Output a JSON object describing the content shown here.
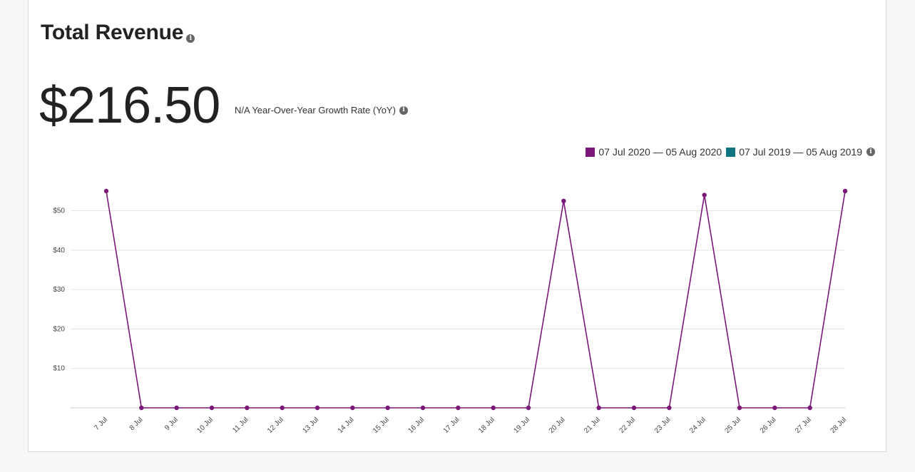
{
  "card": {
    "title": "Total Revenue",
    "value": "$216.50",
    "yoy_text": "N/A Year-Over-Year Growth Rate (YoY)",
    "info_icon": "info-icon"
  },
  "legend": [
    {
      "label": "07 Jul 2020 — 05 Aug 2020",
      "color": "#7b1779"
    },
    {
      "label": "07 Jul 2019 — 05 Aug 2019",
      "color": "#0e7580"
    }
  ],
  "chart_data": {
    "type": "line",
    "x": [
      "7 Jul",
      "8 Jul",
      "9 Jul",
      "10 Jul",
      "11 Jul",
      "12 Jul",
      "13 Jul",
      "14 Jul",
      "15 Jul",
      "16 Jul",
      "17 Jul",
      "18 Jul",
      "19 Jul",
      "20 Jul",
      "21 Jul",
      "22 Jul",
      "23 Jul",
      "24 Jul",
      "25 Jul",
      "26 Jul",
      "27 Jul",
      "28 Jul"
    ],
    "series": [
      {
        "name": "07 Jul 2020 — 05 Aug 2020",
        "color": "#7b1779",
        "values": [
          55,
          0,
          0,
          0,
          0,
          0,
          0,
          0,
          0,
          0,
          0,
          0,
          0,
          52.5,
          0,
          0,
          0,
          54,
          0,
          0,
          0,
          55
        ]
      }
    ],
    "yticks": [
      "$10",
      "$20",
      "$30",
      "$40",
      "$50"
    ],
    "ylim": [
      0,
      60
    ],
    "grid": true
  }
}
